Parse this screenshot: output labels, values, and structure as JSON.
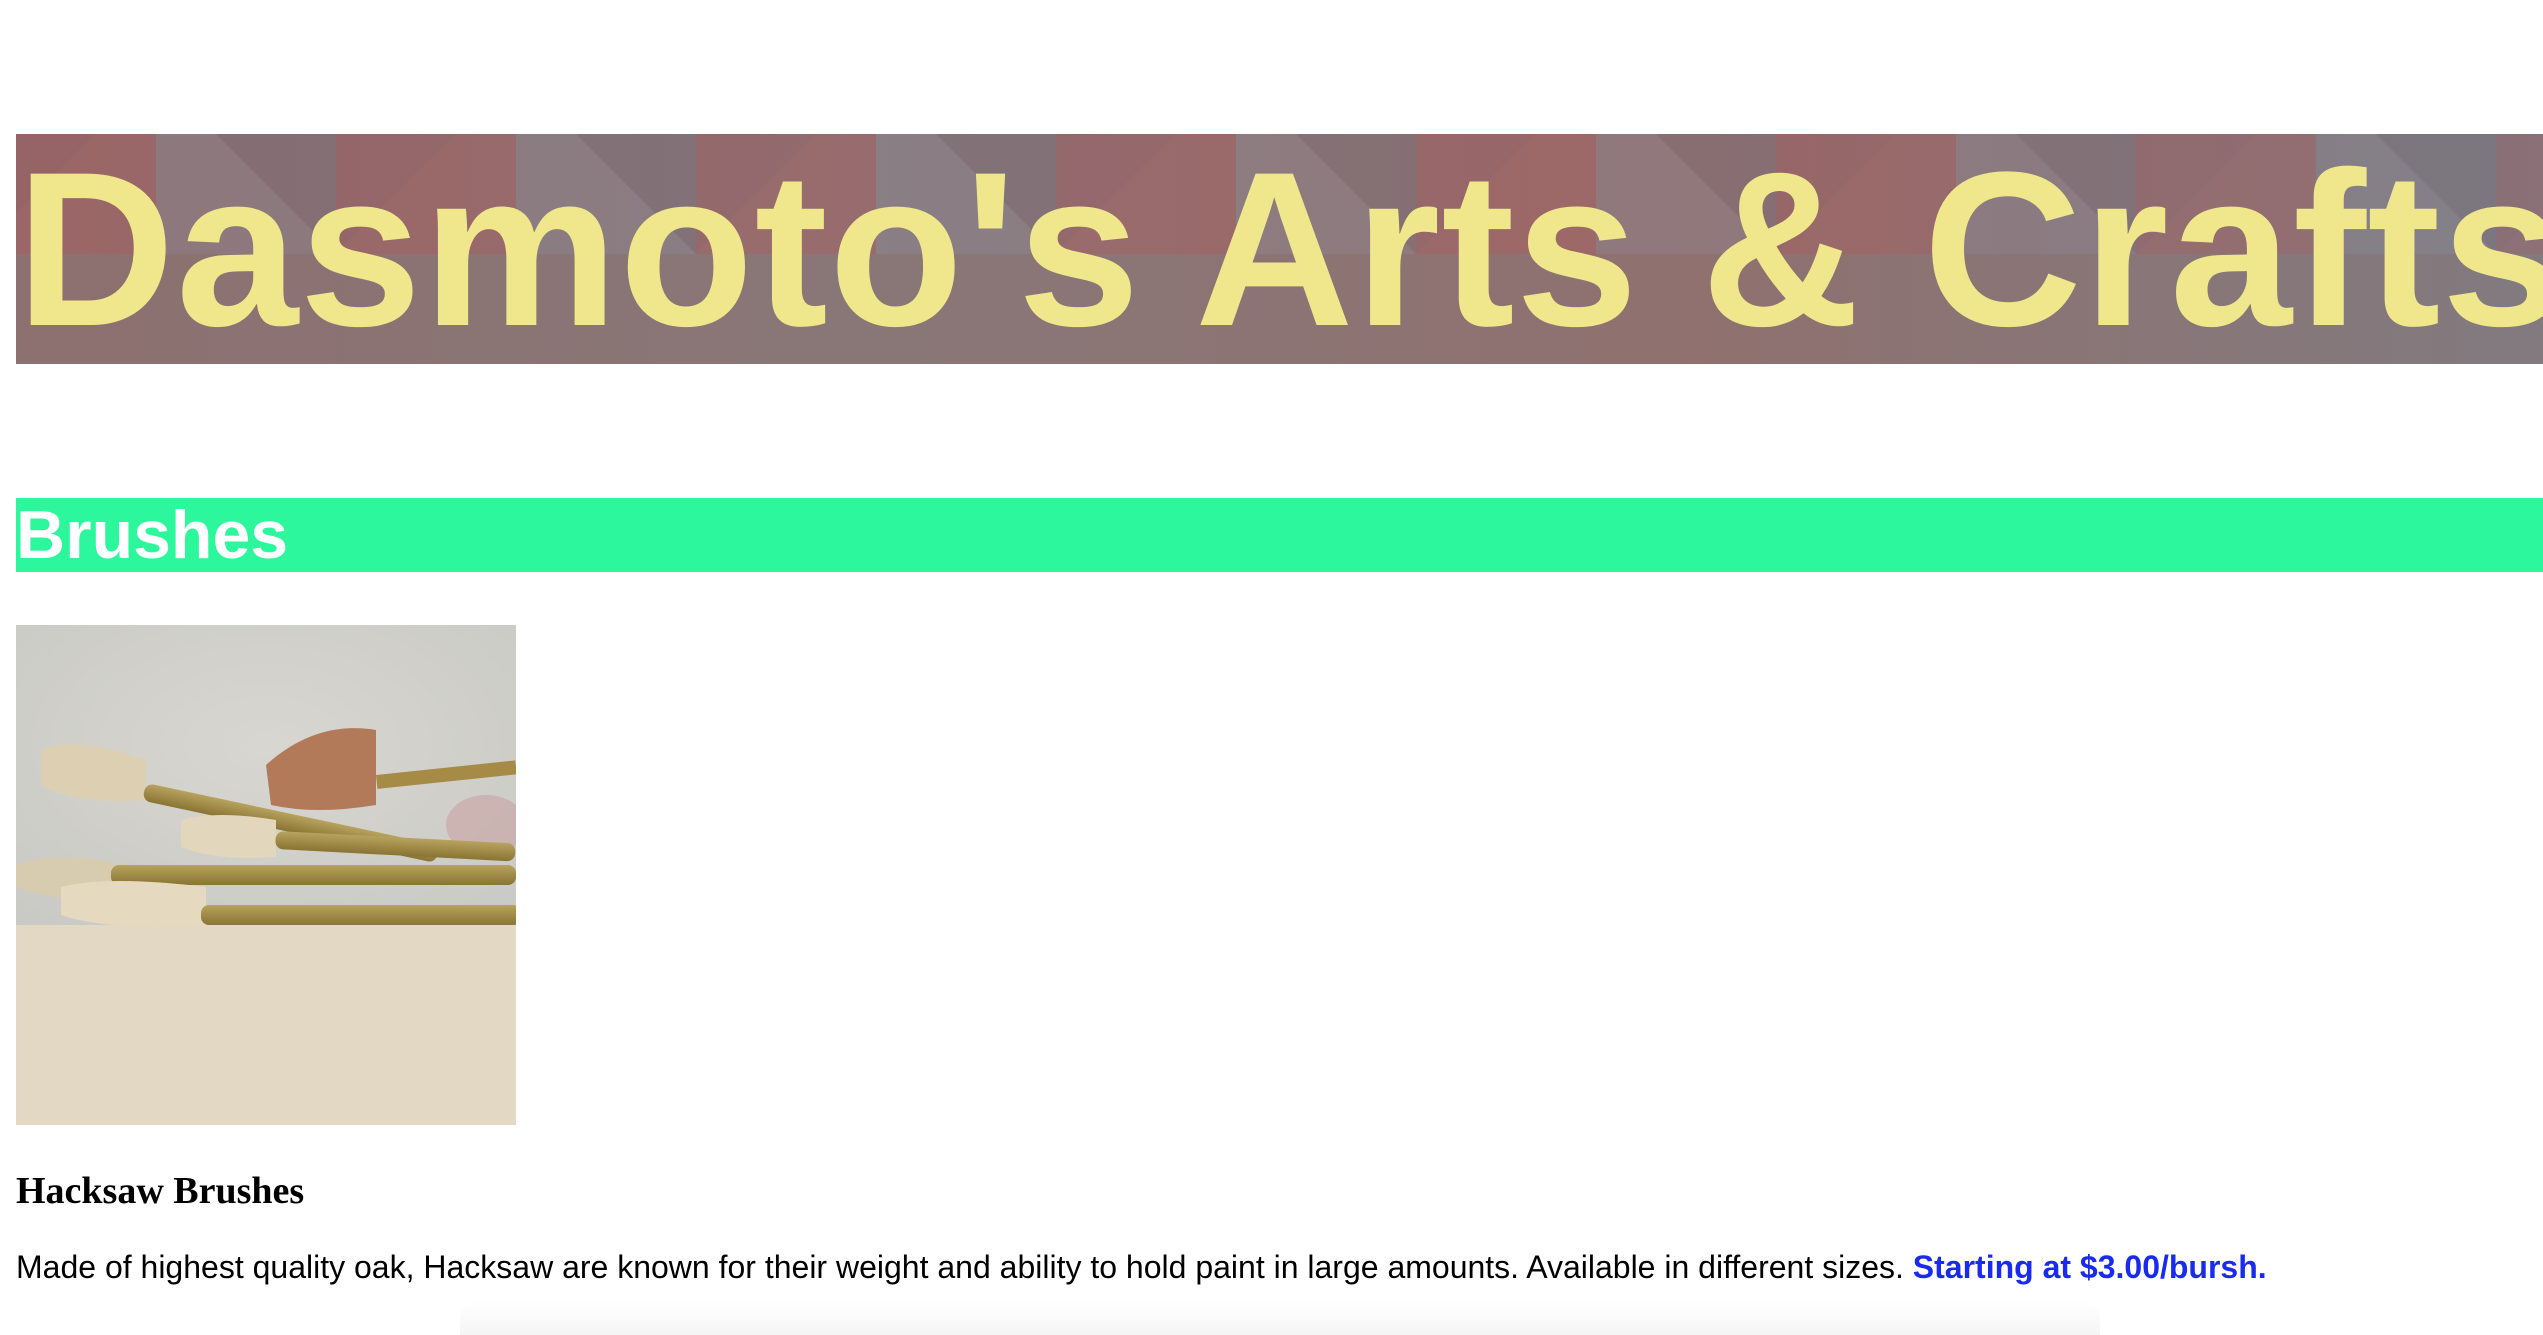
{
  "header": {
    "title": "Dasmoto's Arts & Crafts"
  },
  "sections": [
    {
      "heading": "Brushes",
      "product": {
        "name": "Hacksaw Brushes",
        "description": "Made of highest quality oak, Hacksaw are known for their weight and ability to hold paint in large amounts. Available in different sizes. ",
        "price_text": "Starting at $3.00/bursh."
      }
    }
  ],
  "colors": {
    "title": "#f0e68c",
    "section_bg": "#2cf79c",
    "section_text": "#ffffff",
    "price": "#1a2bf0"
  }
}
